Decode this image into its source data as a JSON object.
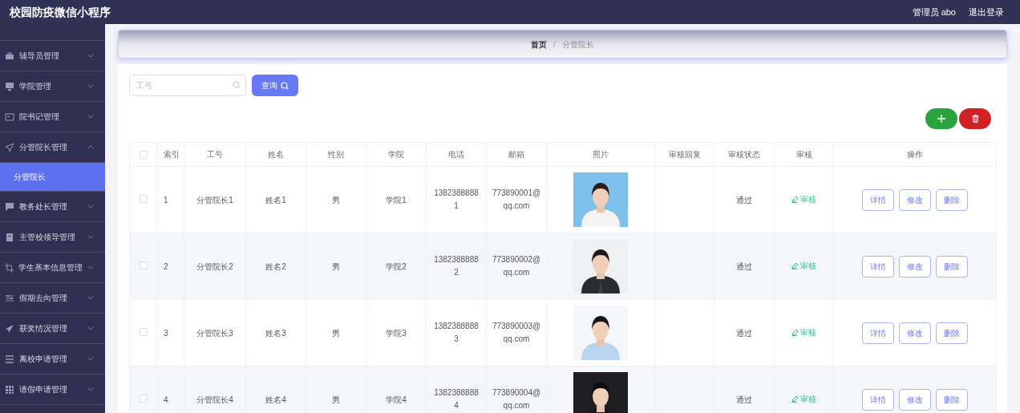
{
  "header": {
    "title": "校园防疫微信小程序",
    "user": "管理员 abo",
    "logout": "退出登录"
  },
  "sidebar": {
    "items": [
      {
        "label": "辅导员管理",
        "expanded": false
      },
      {
        "label": "学院管理",
        "expanded": false
      },
      {
        "label": "院书记管理",
        "expanded": false
      },
      {
        "label": "分管院长管理",
        "expanded": true,
        "children": [
          {
            "label": "分管院长",
            "selected": true
          }
        ]
      },
      {
        "label": "教务处长管理",
        "expanded": false
      },
      {
        "label": "主管校领导管理",
        "expanded": false
      },
      {
        "label": "学生基本信息管理",
        "expanded": false
      },
      {
        "label": "假期去向管理",
        "expanded": false
      },
      {
        "label": "获奖情况管理",
        "expanded": false
      },
      {
        "label": "离校申请管理",
        "expanded": false
      },
      {
        "label": "请假申请管理",
        "expanded": false
      }
    ]
  },
  "breadcrumb": {
    "items": [
      "首页",
      "分管院长"
    ],
    "separator": "/"
  },
  "search": {
    "placeholder": "工号",
    "button": "查询"
  },
  "table": {
    "select_all_checked": false,
    "columns": [
      "索引",
      "工号",
      "姓名",
      "性别",
      "学院",
      "电话",
      "邮箱",
      "照片",
      "审核回复",
      "审核状态",
      "审核",
      "操作"
    ],
    "rows": [
      {
        "checked": false,
        "index": "1",
        "id": "分管院长1",
        "name": "姓名1",
        "gender": "男",
        "college": "学院1",
        "phone": "13823888881",
        "email": "773890001@qq.com",
        "status": "通过",
        "review": "审核",
        "actions": [
          "详情",
          "修改",
          "删除"
        ]
      },
      {
        "checked": false,
        "index": "2",
        "id": "分管院长2",
        "name": "姓名2",
        "gender": "男",
        "college": "学院2",
        "phone": "13823888882",
        "email": "773890002@qq.com",
        "status": "通过",
        "review": "审核",
        "actions": [
          "详情",
          "修改",
          "删除"
        ]
      },
      {
        "checked": false,
        "index": "3",
        "id": "分管院长3",
        "name": "姓名3",
        "gender": "男",
        "college": "学院3",
        "phone": "13823888883",
        "email": "773890003@qq.com",
        "status": "通过",
        "review": "审核",
        "actions": [
          "详情",
          "修改",
          "删除"
        ]
      },
      {
        "checked": false,
        "index": "4",
        "id": "分管院长4",
        "name": "姓名4",
        "gender": "男",
        "college": "学院4",
        "phone": "13823888884",
        "email": "773890004@qq.com",
        "status": "通过",
        "review": "审核",
        "actions": [
          "详情",
          "修改",
          "删除"
        ]
      }
    ]
  }
}
